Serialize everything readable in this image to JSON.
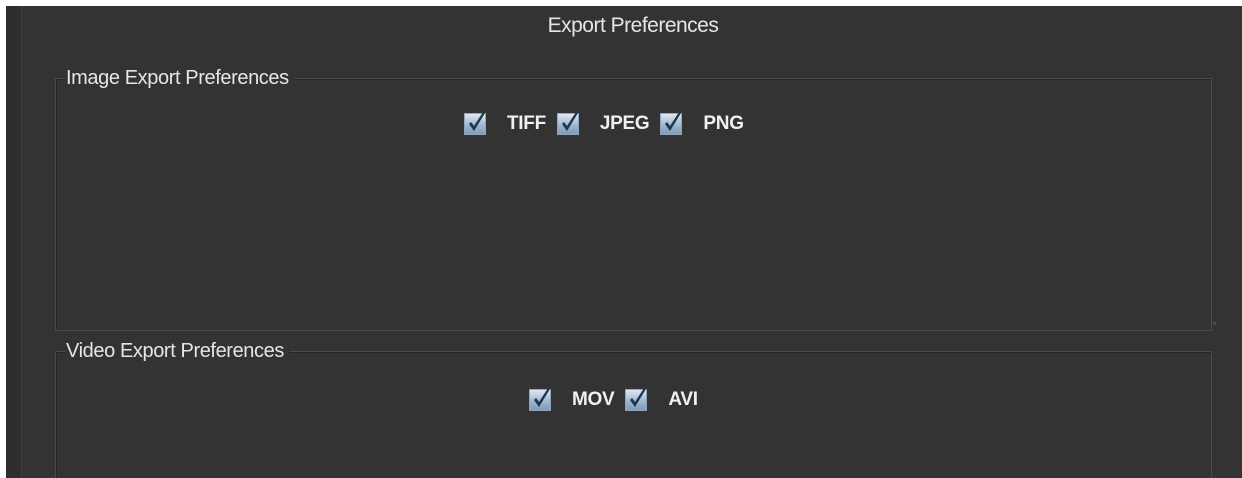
{
  "panel": {
    "title": "Export Preferences"
  },
  "image_export": {
    "legend": "Image Export Preferences",
    "options": [
      {
        "label": "TIFF",
        "checked": true
      },
      {
        "label": "JPEG",
        "checked": true
      },
      {
        "label": "PNG",
        "checked": true
      }
    ]
  },
  "video_export": {
    "legend": "Video Export Preferences",
    "options": [
      {
        "label": "MOV",
        "checked": true
      },
      {
        "label": "AVI",
        "checked": true
      }
    ]
  },
  "colors": {
    "background": "#333333",
    "text": "#e6e6e6",
    "border": "#4a4a4a",
    "checkbox": "#9fb8d1",
    "checkmark": "#1f3550"
  },
  "icons": {
    "checkmark": "checkmark-icon"
  }
}
